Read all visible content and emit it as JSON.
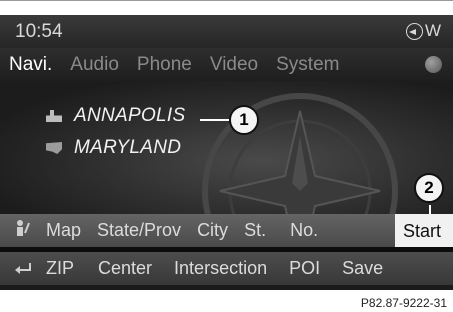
{
  "status": {
    "time": "10:54",
    "heading": "W"
  },
  "main_menu": {
    "items": [
      "Navi",
      "Audio",
      "Phone",
      "Video",
      "System"
    ]
  },
  "destination": {
    "city": "ANNAPOLIS",
    "state": "MARYLAND"
  },
  "callouts": {
    "one": "1",
    "two": "2"
  },
  "menu_bar_1": {
    "map": "Map",
    "state_prov": "State/Prov",
    "city": "City",
    "street": "St.",
    "number": "No.",
    "start": "Start"
  },
  "menu_bar_2": {
    "zip": "ZIP",
    "center": "Center",
    "intersection": "Intersection",
    "poi": "POI",
    "save": "Save"
  },
  "reference": "P82.87-9222-31",
  "icons": [
    "compass-icon",
    "globe-icon",
    "city-icon",
    "state-icon",
    "person-icon",
    "back-icon"
  ]
}
